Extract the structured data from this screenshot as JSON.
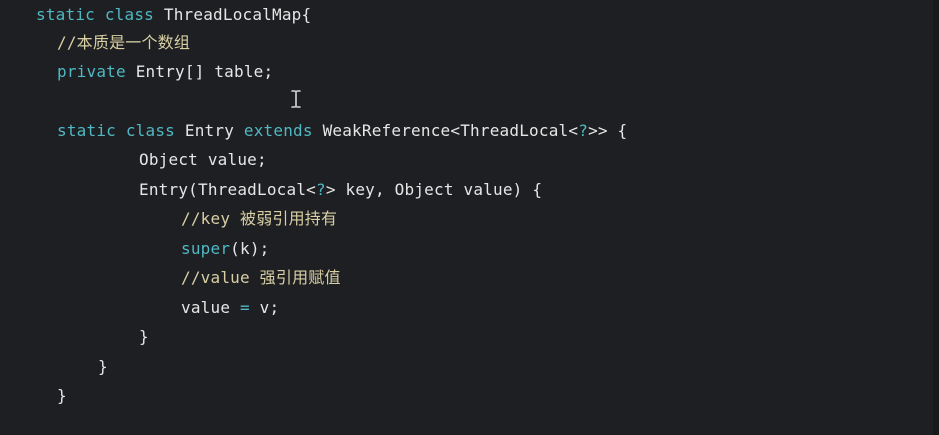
{
  "code": {
    "line1": {
      "kw1": "static",
      "kw2": "class",
      "name": "ThreadLocalMap{"
    },
    "line2": {
      "comment": "//本质是一个数组"
    },
    "line3": {
      "kw": "private",
      "rest": "Entry[] table;"
    },
    "line5": {
      "kw1": "static",
      "kw2": "class",
      "name": "Entry",
      "kw3": "extends",
      "parent_a": "WeakReference<ThreadLocal<",
      "wildcard": "?",
      "parent_b": ">> {"
    },
    "line6": {
      "text": "Object value;"
    },
    "line7": {
      "a": "Entry(ThreadLocal<",
      "wildcard": "?",
      "b": "> key, Object value) {"
    },
    "line8": {
      "comment": "//key 被弱引用持有"
    },
    "line9": {
      "kw": "super",
      "rest": "(k);"
    },
    "line10": {
      "comment": "//value 强引用赋值"
    },
    "line11": {
      "a": "value ",
      "op": "=",
      "b": " v;"
    },
    "line12": {
      "text": "}"
    },
    "line13": {
      "text": "}"
    },
    "line14": {
      "text": "}"
    }
  },
  "cursor": {
    "icon": "text-cursor-icon"
  },
  "colors": {
    "background": "#1e1f22",
    "keyword": "#4fb8c2",
    "text": "#e6e6e6",
    "comment": "#d8cfa4"
  }
}
